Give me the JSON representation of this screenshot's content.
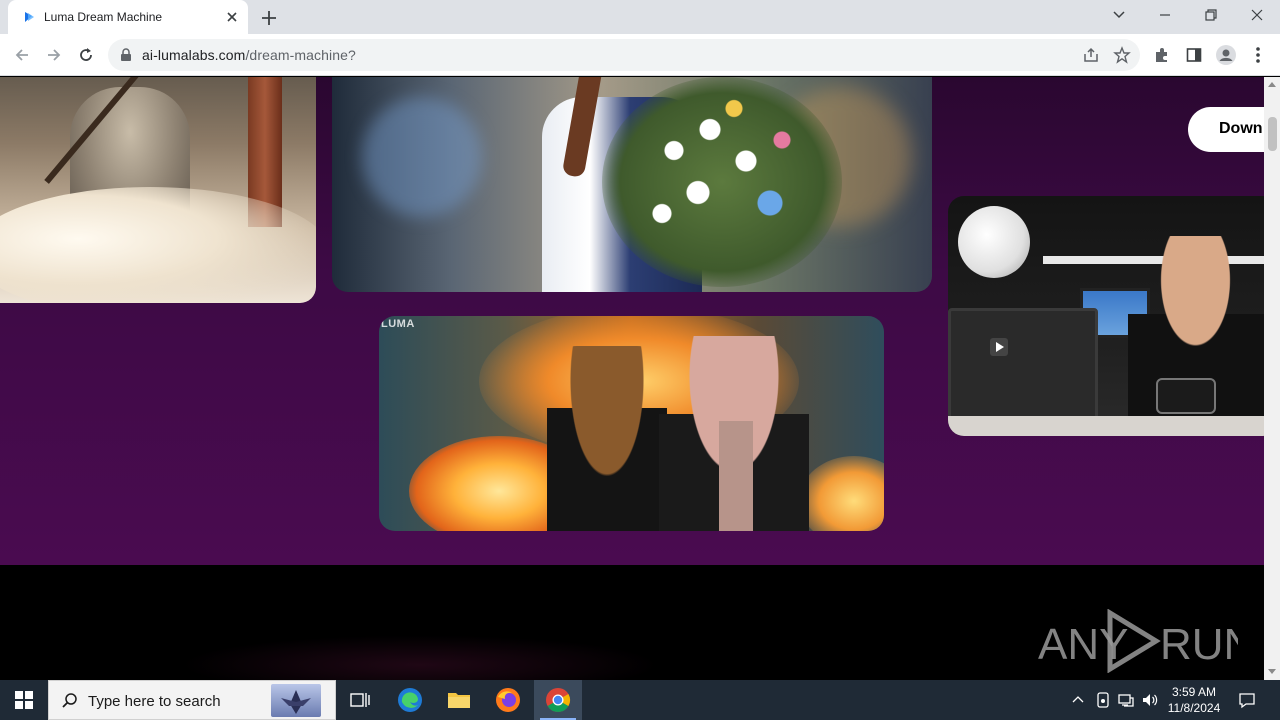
{
  "browser": {
    "tab_title": "Luma Dream Machine",
    "url_host": "ai-lumalabs.com",
    "url_path": "/dream-machine?"
  },
  "page": {
    "download_button_label": "Down",
    "card_watermark": "LUMA",
    "colors": {
      "page_top": "#2a0730",
      "page_bottom": "#4a0b50",
      "footer": "#000000",
      "button_bg": "#ffffff"
    }
  },
  "watermark": {
    "text_left": "ANY",
    "text_right": "RUN"
  },
  "taskbar": {
    "search_placeholder": "Type here to search",
    "time": "3:59 AM",
    "date": "11/8/2024",
    "apps": [
      "task-view",
      "edge",
      "file-explorer",
      "firefox",
      "chrome"
    ]
  }
}
